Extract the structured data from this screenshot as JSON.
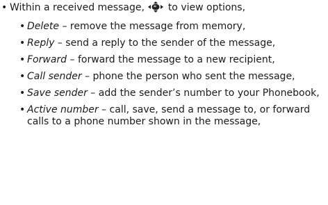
{
  "intro": {
    "bullet": "•",
    "before_icon": "Within a received message,",
    "icon": "navigation-key-icon",
    "after_icon": "to view options,"
  },
  "options": [
    {
      "term": "Delete",
      "desc": " – remove the message from memory,"
    },
    {
      "term": "Reply",
      "desc": " – send a reply to the sender of the message,"
    },
    {
      "term": "Forward",
      "desc": " – forward the message to a new recipient,"
    },
    {
      "term": "Call sender",
      "desc": " – phone the person who sent the message,"
    },
    {
      "term": "Save sender",
      "desc": " – add the sender’s number to your Phonebook,"
    },
    {
      "term": "Active number",
      "desc": " – call, save, send a message to, or forward calls to a phone number shown in the message,"
    }
  ],
  "colors": {
    "text": "#1a1a1a",
    "background": "#ffffff"
  }
}
